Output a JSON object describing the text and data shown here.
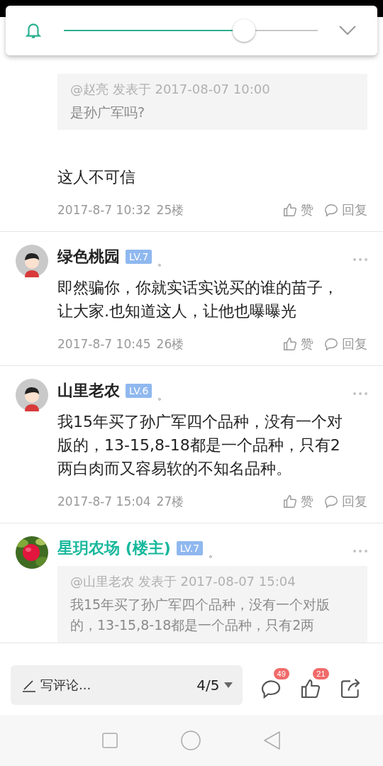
{
  "volume_panel": {
    "level": 0.71
  },
  "posts": [
    {
      "quote": {
        "header": "@赵亮 发表于 2017-08-07 10:00",
        "text": "是孙广军吗?"
      },
      "body": "这人不可信",
      "time": "2017-8-7 10:32",
      "floor": "25楼",
      "like": "赞",
      "reply": "回复"
    },
    {
      "author": {
        "name": "绿色桃园",
        "is_op": false,
        "level": "LV.7",
        "mark": "。",
        "avatar": {
          "kind": "figure"
        }
      },
      "body": "即然骗你，你就实话实说买的谁的苗子，让大家.也知道这人，让他也曝曝光",
      "time": "2017-8-7 10:45",
      "floor": "26楼",
      "like": "赞",
      "reply": "回复"
    },
    {
      "author": {
        "name": "山里老农",
        "is_op": false,
        "level": "LV.6",
        "mark": "。",
        "avatar": {
          "kind": "figure"
        }
      },
      "body": "我15年买了孙广军四个品种，没有一个对版的，13-15,8-18都是一个品种，只有2两白肉而又容易软的不知名品种。",
      "time": "2017-8-7 15:04",
      "floor": "27楼",
      "like": "赞",
      "reply": "回复"
    },
    {
      "author": {
        "name": "星玥农场 (楼主)",
        "is_op": true,
        "level": "LV.7",
        "mark": "。"
      },
      "quote": {
        "header": "@山里老农 发表于 2017-08-07 15:04",
        "text": "我15年买了孙广军四个品种，没有一个对版的，13-15,8-18都是一个品种，只有2两"
      }
    }
  ],
  "bottom_bar": {
    "placeholder": "写评论...",
    "page": "4/5",
    "comment_count": "49",
    "like_count": "21"
  }
}
